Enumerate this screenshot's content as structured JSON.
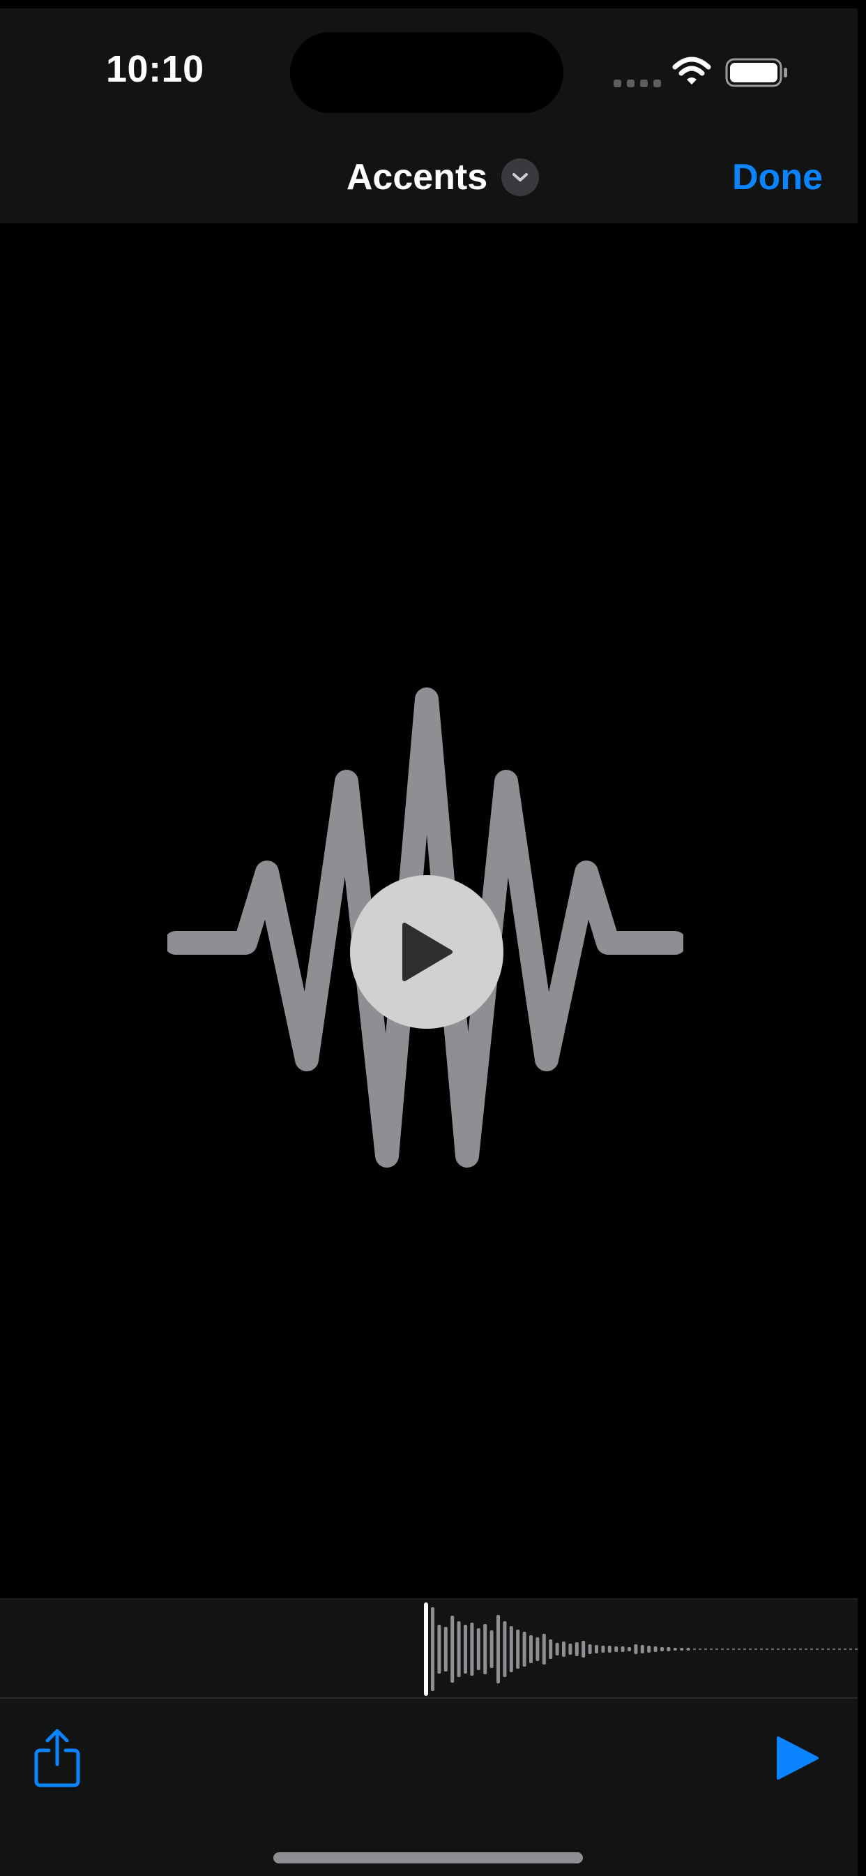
{
  "status_bar": {
    "time": "10:10"
  },
  "nav": {
    "title": "Accents",
    "done_label": "Done"
  },
  "icons": {
    "title_chevron": "chevron-down-icon",
    "wifi": "wifi-icon",
    "battery": "battery-icon",
    "center_art": "sound-wave-icon",
    "center_play": "play-icon",
    "share": "share-icon",
    "toolbar_play": "play-icon"
  },
  "playback": {
    "progress": 0
  },
  "colors": {
    "accent": "#0a84ff",
    "wave_gray": "#8e8e93",
    "bar_background": "#121313"
  }
}
